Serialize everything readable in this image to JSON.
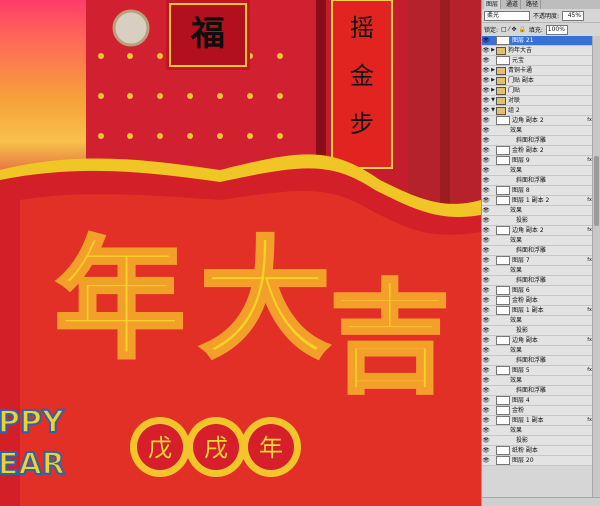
{
  "artwork": {
    "top_char": "福",
    "banner_lines": [
      "摇",
      "金",
      "步"
    ],
    "main_chars": [
      "年",
      "大",
      "吉"
    ],
    "badge_chars": [
      "戊",
      "戌",
      "年"
    ],
    "happy_text": "PPY",
    "year_text": "EAR"
  },
  "panel": {
    "tabs": [
      "图层",
      "通道",
      "路径"
    ],
    "blend_mode": "柔光",
    "opacity_label": "不透明度:",
    "opacity_value": "45%",
    "lock_label": "锁定:",
    "fill_label": "填充:",
    "fill_value": "100%",
    "layers": [
      {
        "name": "图层 21",
        "type": "layer",
        "active": true
      },
      {
        "name": "狗年大吉",
        "type": "folder",
        "collapsed": true
      },
      {
        "name": "元宝",
        "type": "layer"
      },
      {
        "name": "青铜卡通",
        "type": "folder",
        "collapsed": true
      },
      {
        "name": "门贴 副本",
        "type": "folder",
        "collapsed": true
      },
      {
        "name": "门贴",
        "type": "folder",
        "collapsed": true
      },
      {
        "name": "对联",
        "type": "folder",
        "collapsed": false
      },
      {
        "name": "组 2",
        "type": "folder",
        "collapsed": false
      },
      {
        "name": "边角 副本 2",
        "type": "layer",
        "fx": true
      },
      {
        "name": "效果",
        "type": "fx-group"
      },
      {
        "name": "斜面和浮雕",
        "type": "fx"
      },
      {
        "name": "金粉 副本 2",
        "type": "layer"
      },
      {
        "name": "图层 9",
        "type": "layer",
        "fx": true
      },
      {
        "name": "效果",
        "type": "fx-group"
      },
      {
        "name": "斜面和浮雕",
        "type": "fx"
      },
      {
        "name": "图层 8",
        "type": "layer"
      },
      {
        "name": "图层 1 副本 2",
        "type": "layer",
        "fx": true
      },
      {
        "name": "效果",
        "type": "fx-group"
      },
      {
        "name": "投影",
        "type": "fx"
      },
      {
        "name": "边角 副本 2",
        "type": "layer",
        "fx": true
      },
      {
        "name": "效果",
        "type": "fx-group"
      },
      {
        "name": "斜面和浮雕",
        "type": "fx"
      },
      {
        "name": "图层 7",
        "type": "layer",
        "fx": true
      },
      {
        "name": "效果",
        "type": "fx-group"
      },
      {
        "name": "斜面和浮雕",
        "type": "fx"
      },
      {
        "name": "图层 6",
        "type": "layer"
      },
      {
        "name": "金粉 副本",
        "type": "layer"
      },
      {
        "name": "图层 1 副本",
        "type": "layer",
        "fx": true
      },
      {
        "name": "效果",
        "type": "fx-group"
      },
      {
        "name": "投影",
        "type": "fx"
      },
      {
        "name": "边角 副本",
        "type": "layer",
        "fx": true
      },
      {
        "name": "效果",
        "type": "fx-group"
      },
      {
        "name": "斜面和浮雕",
        "type": "fx"
      },
      {
        "name": "图层 5",
        "type": "layer",
        "fx": true
      },
      {
        "name": "效果",
        "type": "fx-group"
      },
      {
        "name": "斜面和浮雕",
        "type": "fx"
      },
      {
        "name": "图层 4",
        "type": "layer"
      },
      {
        "name": "金粉",
        "type": "layer"
      },
      {
        "name": "图层 1 副本",
        "type": "layer",
        "fx": true
      },
      {
        "name": "效果",
        "type": "fx-group"
      },
      {
        "name": "投影",
        "type": "fx"
      },
      {
        "name": "纸粉 副本",
        "type": "layer"
      },
      {
        "name": "图层 20",
        "type": "layer"
      }
    ]
  }
}
